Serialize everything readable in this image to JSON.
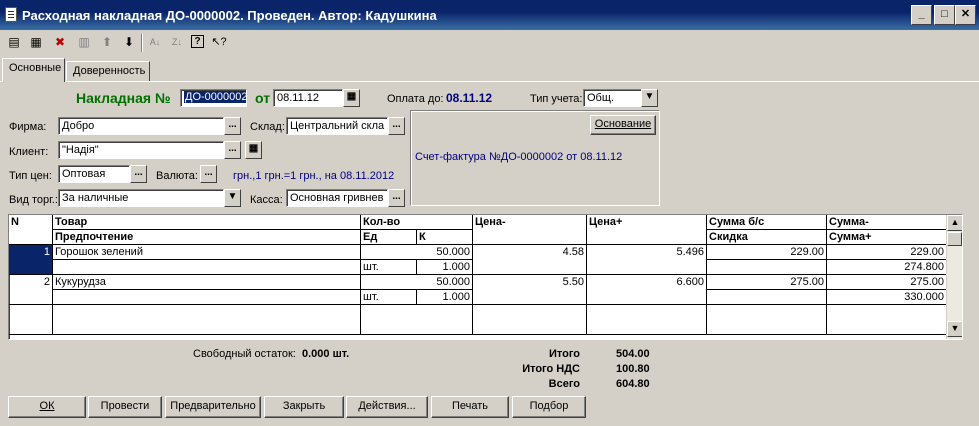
{
  "window": {
    "title": "Расходная накладная  ДО-0000002. Проведен. Автор: Кадушкина"
  },
  "toolbar": {
    "icons": [
      "new-row-icon",
      "copy-row-icon",
      "delete-row-icon",
      "edit-row-icon",
      "move-up-icon",
      "move-down-icon",
      "sort-asc-icon",
      "sort-desc-icon",
      "help-icon",
      "whats-this-icon"
    ]
  },
  "tabs": [
    {
      "label": "Основные",
      "active": true
    },
    {
      "label": "Доверенность",
      "active": false
    }
  ],
  "header": {
    "doc_label": "Накладная №",
    "doc_number": "ДО-0000002",
    "from_label": "от",
    "date": "08.11.12",
    "pay_label": "Оплата до:",
    "pay_date": "08.11.12",
    "acct_label": "Тип учета:",
    "acct_value": "Общ."
  },
  "form": {
    "firm_label": "Фирма:",
    "firm_value": "Добро",
    "warehouse_label": "Склад:",
    "warehouse_value": "Центральний скла",
    "client_label": "Клиент:",
    "client_value": "\"Надія\"",
    "price_type_label": "Тип цен:",
    "price_type_value": "Оптовая",
    "currency_label": "Валюта:",
    "currency_info": "грн.,1 грн.=1 грн., на 08.11.2012",
    "trade_label": "Вид торг.:",
    "trade_value": "За наличные",
    "cash_label": "Касса:",
    "cash_value": "Основная гривнев",
    "basis_button": "Основание",
    "invoice_text": "Счет-фактура №ДО-0000002 от 08.11.12"
  },
  "table": {
    "headers": {
      "n": "N",
      "goods": "Товар",
      "preference": "Предпочтение",
      "qty": "Кол-во",
      "unit": "Ед",
      "k": "К",
      "price_minus": "Цена-",
      "price_plus": "Цена+",
      "sum_no_vat": "Сумма б/с",
      "discount": "Скидка",
      "sum_minus": "Сумма-",
      "sum_plus": "Сумма+"
    },
    "rows": [
      {
        "n": "1",
        "goods": "Горошок зелений",
        "qty": "50.000",
        "unit": "шт.",
        "k": "1.000",
        "price_minus": "4.58",
        "price_plus": "5.496",
        "sum_no_vat": "229.00",
        "sum_minus": "229.00",
        "sum_plus": "274.800"
      },
      {
        "n": "2",
        "goods": "Кукурудза",
        "qty": "50.000",
        "unit": "шт.",
        "k": "1.000",
        "price_minus": "5.50",
        "price_plus": "6.600",
        "sum_no_vat": "275.00",
        "sum_minus": "275.00",
        "sum_plus": "330.000"
      }
    ]
  },
  "footer": {
    "free_stock_label": "Свободный остаток:",
    "free_stock_value": "0.000 шт.",
    "total_label": "Итого",
    "total_value": "504.00",
    "vat_label": "Итого НДС",
    "vat_value": "100.80",
    "grand_label": "Всего",
    "grand_value": "604.80"
  },
  "buttons": {
    "ok": "ОК",
    "post": "Провести",
    "preview": "Предварительно",
    "close": "Закрыть",
    "actions": "Действия...",
    "print": "Печать",
    "select": "Подбор"
  },
  "colors": {
    "title_bg": "#0a246a",
    "doc_green": "#007000",
    "link_blue": "#000080",
    "selection": "#0a246a"
  }
}
